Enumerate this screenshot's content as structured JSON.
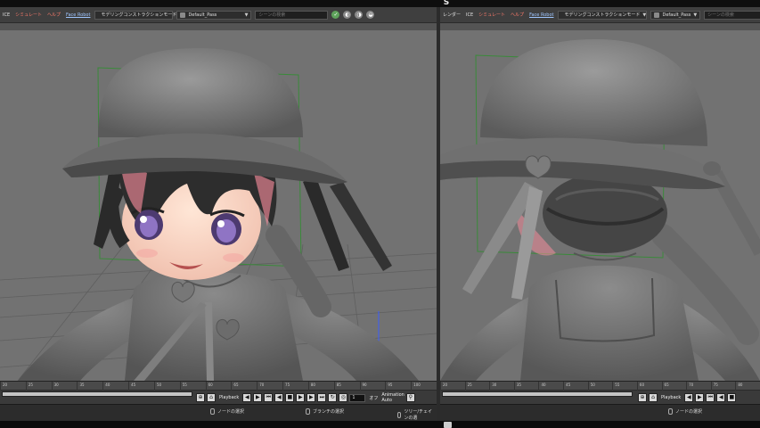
{
  "left_pane": {
    "menu": [
      {
        "label": "ICE",
        "style": "normal"
      },
      {
        "label": "シミュレート",
        "style": "red"
      },
      {
        "label": "ヘルプ",
        "style": "red"
      },
      {
        "label": "Face Robot",
        "style": "blue"
      }
    ],
    "mode_dropdown": "モデリングコンストラクションモード",
    "pass_dropdown": "Default_Pass",
    "search_placeholder": "シーンの検索",
    "sub_label": "",
    "ruler_ticks": [
      "20",
      "25",
      "30",
      "35",
      "40",
      "45",
      "50",
      "55",
      "60",
      "65",
      "70",
      "75",
      "80",
      "85",
      "90",
      "95",
      "100"
    ],
    "playback_label": "Playback",
    "frame_value": "1",
    "frame_suffix": "オフ",
    "animation_label": "Animation",
    "auto_label": "Auto",
    "status": {
      "left": "ノードの選択",
      "middle": "ブランチの選択",
      "right": "ツリー/チェインの選"
    }
  },
  "right_pane": {
    "menu": [
      {
        "label": "レンダー",
        "style": "normal"
      },
      {
        "label": "ICE",
        "style": "normal"
      },
      {
        "label": "シミュレート",
        "style": "red"
      },
      {
        "label": "ヘルプ",
        "style": "red"
      },
      {
        "label": "Face Robot",
        "style": "blue"
      }
    ],
    "mode_dropdown": "モデリングコンストラクションモード",
    "pass_dropdown": "Default_Pass",
    "search_placeholder": "シーンの検索",
    "ruler_ticks": [
      "20",
      "25",
      "30",
      "35",
      "40",
      "45",
      "50",
      "55",
      "60",
      "65",
      "70",
      "75",
      "80"
    ],
    "playback_label": "Playback",
    "status": {
      "left": "ノードの選択"
    }
  },
  "colors": {
    "viewport_bg": "#6e6e6e",
    "menubar_bg": "#3f3f3f",
    "bbox_green": "#3a8a3a",
    "menu_red": "#ff7b6b",
    "menu_blue": "#9fc6ff"
  },
  "icons": [
    "green-check-icon",
    "magnet-icon",
    "lock-icon",
    "play-icon",
    "rewind-icon",
    "fast-forward-icon",
    "loop-icon",
    "mouse-icon"
  ]
}
